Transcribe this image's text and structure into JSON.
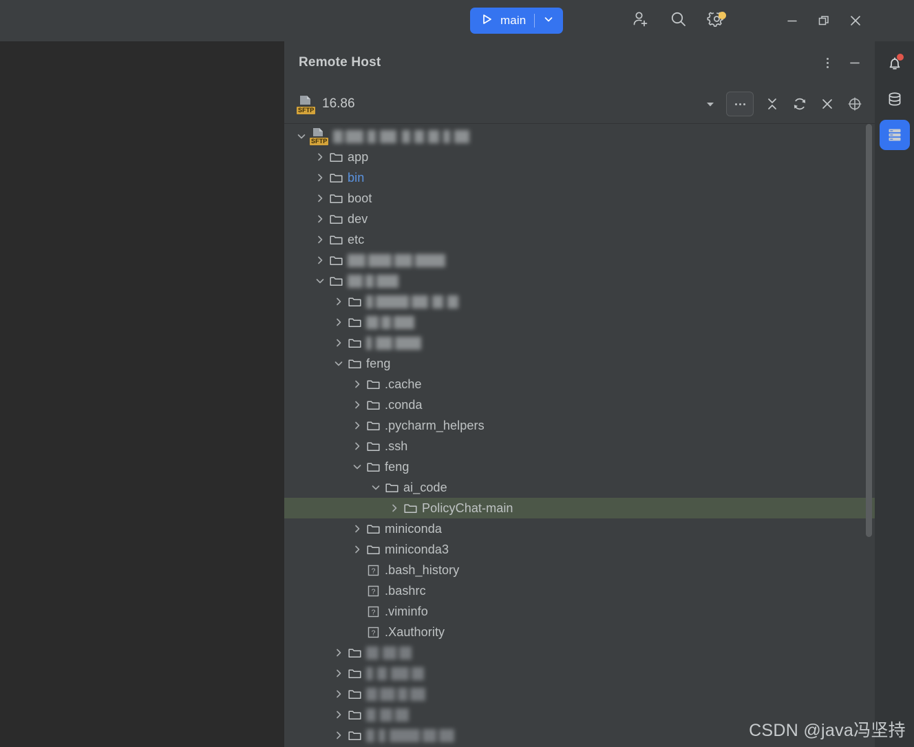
{
  "titlebar": {
    "run_config": "main",
    "play_icon": "play-icon",
    "chevron_icon": "chevron-down-icon",
    "icons": [
      {
        "name": "add-user-icon",
        "label": "Add user"
      },
      {
        "name": "search-icon",
        "label": "Search"
      },
      {
        "name": "settings-gear-icon",
        "label": "Settings",
        "badge": true
      }
    ],
    "window_controls": [
      {
        "name": "minimize-button",
        "glyph": "minimize"
      },
      {
        "name": "restore-button",
        "glyph": "restore"
      },
      {
        "name": "close-button",
        "glyph": "close"
      }
    ],
    "accent_color": "#3574f0",
    "badge_color": "#f2c55c"
  },
  "tool_window": {
    "title": "Remote Host",
    "header_actions": [
      {
        "name": "more-options-button",
        "icon": "vertical-dots-icon"
      },
      {
        "name": "hide-panel-button",
        "icon": "minimize-icon"
      }
    ],
    "connection": {
      "name": "16.86",
      "protocol_badge": "SFTP",
      "badge_color": "#d4a33a",
      "actions": [
        {
          "name": "connection-dropdown-button",
          "icon": "chevron-down-icon"
        },
        {
          "name": "more-actions-button",
          "icon": "horizontal-dots-icon"
        },
        {
          "name": "collapse-all-button",
          "icon": "collapse-all-icon"
        },
        {
          "name": "refresh-button",
          "icon": "refresh-icon"
        },
        {
          "name": "close-connection-button",
          "icon": "close-icon"
        },
        {
          "name": "locate-button",
          "icon": "crosshair-target-icon"
        }
      ]
    }
  },
  "tree": {
    "selection_color": "#4c5748",
    "rows": [
      {
        "indent": 0,
        "twisty": "expanded",
        "icon": "sftp-host-icon",
        "label": "",
        "redacted": true,
        "redact_segments": [
          [
            0,
            14
          ],
          [
            18,
            26
          ],
          [
            50,
            12
          ],
          [
            68,
            24
          ],
          [
            100,
            12
          ],
          [
            118,
            14
          ],
          [
            138,
            16
          ],
          [
            160,
            10
          ],
          [
            176,
            22
          ]
        ]
      },
      {
        "indent": 1,
        "twisty": "collapsed",
        "icon": "folder-icon",
        "label": "app"
      },
      {
        "indent": 1,
        "twisty": "collapsed",
        "icon": "folder-icon",
        "label": "bin",
        "link": true
      },
      {
        "indent": 1,
        "twisty": "collapsed",
        "icon": "folder-icon",
        "label": "boot"
      },
      {
        "indent": 1,
        "twisty": "collapsed",
        "icon": "folder-icon",
        "label": "dev"
      },
      {
        "indent": 1,
        "twisty": "collapsed",
        "icon": "folder-icon",
        "label": "etc"
      },
      {
        "indent": 1,
        "twisty": "collapsed",
        "icon": "folder-icon",
        "label": "",
        "redacted": true,
        "redact_segments": [
          [
            0,
            26
          ],
          [
            30,
            34
          ],
          [
            68,
            26
          ],
          [
            98,
            44
          ]
        ]
      },
      {
        "indent": 1,
        "twisty": "expanded",
        "icon": "folder-icon",
        "label": "",
        "redacted": true,
        "redact_segments": [
          [
            0,
            22
          ],
          [
            26,
            12
          ],
          [
            42,
            32
          ]
        ]
      },
      {
        "indent": 2,
        "twisty": "collapsed",
        "icon": "folder-icon",
        "label": "",
        "redacted": true,
        "redact_segments": [
          [
            0,
            10
          ],
          [
            14,
            48
          ],
          [
            66,
            24
          ],
          [
            96,
            16
          ],
          [
            118,
            16
          ]
        ]
      },
      {
        "indent": 2,
        "twisty": "collapsed",
        "icon": "folder-icon",
        "label": "",
        "redacted": true,
        "redact_segments": [
          [
            0,
            18
          ],
          [
            22,
            14
          ],
          [
            40,
            30
          ]
        ]
      },
      {
        "indent": 2,
        "twisty": "collapsed",
        "icon": "folder-icon",
        "label": "",
        "redacted": true,
        "redact_segments": [
          [
            0,
            8
          ],
          [
            14,
            24
          ],
          [
            42,
            38
          ]
        ]
      },
      {
        "indent": 2,
        "twisty": "expanded",
        "icon": "folder-icon",
        "label": "feng"
      },
      {
        "indent": 3,
        "twisty": "collapsed",
        "icon": "folder-icon",
        "label": ".cache"
      },
      {
        "indent": 3,
        "twisty": "collapsed",
        "icon": "folder-icon",
        "label": ".conda"
      },
      {
        "indent": 3,
        "twisty": "collapsed",
        "icon": "folder-icon",
        "label": ".pycharm_helpers"
      },
      {
        "indent": 3,
        "twisty": "collapsed",
        "icon": "folder-icon",
        "label": ".ssh"
      },
      {
        "indent": 3,
        "twisty": "expanded",
        "icon": "folder-icon",
        "label": "feng"
      },
      {
        "indent": 4,
        "twisty": "expanded",
        "icon": "folder-icon",
        "label": "ai_code"
      },
      {
        "indent": 5,
        "twisty": "collapsed",
        "icon": "folder-icon",
        "label": "PolicyChat-main",
        "selected": true
      },
      {
        "indent": 3,
        "twisty": "collapsed",
        "icon": "folder-icon",
        "label": "miniconda"
      },
      {
        "indent": 3,
        "twisty": "collapsed",
        "icon": "folder-icon",
        "label": "miniconda3"
      },
      {
        "indent": 3,
        "twisty": "none",
        "icon": "unknown-file-icon",
        "label": ".bash_history"
      },
      {
        "indent": 3,
        "twisty": "none",
        "icon": "unknown-file-icon",
        "label": ".bashrc"
      },
      {
        "indent": 3,
        "twisty": "none",
        "icon": "unknown-file-icon",
        "label": ".viminfo"
      },
      {
        "indent": 3,
        "twisty": "none",
        "icon": "unknown-file-icon",
        "label": ".Xauthority"
      },
      {
        "indent": 2,
        "twisty": "collapsed",
        "icon": "folder-icon",
        "label": "",
        "redacted": true,
        "redact_segments": [
          [
            0,
            18
          ],
          [
            24,
            20
          ],
          [
            48,
            18
          ]
        ]
      },
      {
        "indent": 2,
        "twisty": "collapsed",
        "icon": "folder-icon",
        "label": "",
        "redacted": true,
        "redact_segments": [
          [
            0,
            10
          ],
          [
            16,
            14
          ],
          [
            36,
            26
          ],
          [
            66,
            18
          ]
        ]
      },
      {
        "indent": 2,
        "twisty": "collapsed",
        "icon": "folder-icon",
        "label": "",
        "redacted": true,
        "redact_segments": [
          [
            0,
            16
          ],
          [
            20,
            22
          ],
          [
            46,
            14
          ],
          [
            64,
            22
          ]
        ]
      },
      {
        "indent": 2,
        "twisty": "collapsed",
        "icon": "folder-icon",
        "label": "",
        "redacted": true,
        "redact_segments": [
          [
            0,
            14
          ],
          [
            20,
            18
          ],
          [
            42,
            20
          ]
        ]
      },
      {
        "indent": 2,
        "twisty": "collapsed",
        "icon": "folder-icon",
        "label": "",
        "redacted": true,
        "redact_segments": [
          [
            0,
            12
          ],
          [
            18,
            10
          ],
          [
            34,
            44
          ],
          [
            82,
            20
          ],
          [
            106,
            22
          ]
        ]
      }
    ]
  },
  "stripe": {
    "buttons": [
      {
        "name": "notifications-button",
        "icon": "bell-icon",
        "badge": true,
        "active": false
      },
      {
        "name": "database-button",
        "icon": "database-icon",
        "active": false
      },
      {
        "name": "remote-host-button",
        "icon": "server-list-icon",
        "active": true
      }
    ]
  },
  "watermark": "CSDN @java冯坚持"
}
